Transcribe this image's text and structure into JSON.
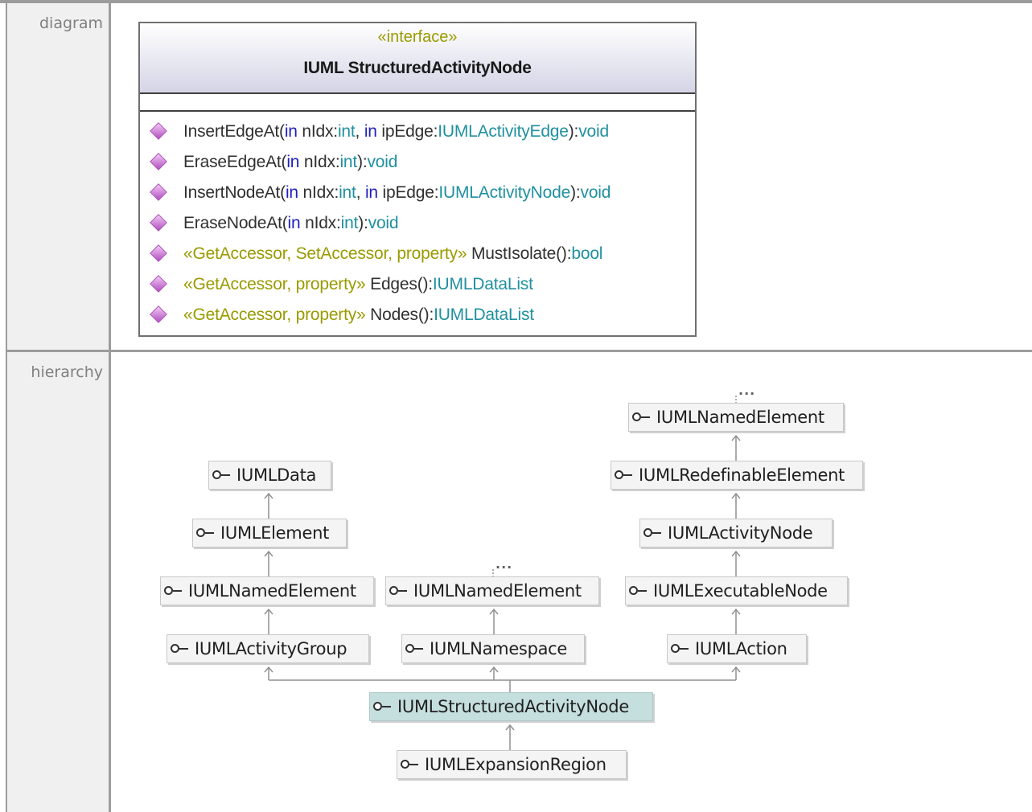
{
  "sections": {
    "diagram_label": "diagram",
    "hierarchy_label": "hierarchy"
  },
  "interface": {
    "stereotype": "«interface»",
    "name": "IUML StructuredActivityNode",
    "operations": [
      {
        "parts": [
          [
            "n",
            "InsertEdgeAt("
          ],
          [
            "k",
            "in"
          ],
          [
            "n",
            " nIdx:"
          ],
          [
            "t",
            "int"
          ],
          [
            "n",
            ", "
          ],
          [
            "k",
            "in"
          ],
          [
            "n",
            " ipEdge:"
          ],
          [
            "t",
            "IUMLActivityEdge"
          ],
          [
            "n",
            "):"
          ],
          [
            "t",
            "void"
          ]
        ]
      },
      {
        "parts": [
          [
            "n",
            "EraseEdgeAt("
          ],
          [
            "k",
            "in"
          ],
          [
            "n",
            " nIdx:"
          ],
          [
            "t",
            "int"
          ],
          [
            "n",
            "):"
          ],
          [
            "t",
            "void"
          ]
        ]
      },
      {
        "parts": [
          [
            "n",
            "InsertNodeAt("
          ],
          [
            "k",
            "in"
          ],
          [
            "n",
            " nIdx:"
          ],
          [
            "t",
            "int"
          ],
          [
            "n",
            ", "
          ],
          [
            "k",
            "in"
          ],
          [
            "n",
            " ipEdge:"
          ],
          [
            "t",
            "IUMLActivityNode"
          ],
          [
            "n",
            "):"
          ],
          [
            "t",
            "void"
          ]
        ]
      },
      {
        "parts": [
          [
            "n",
            "EraseNodeAt("
          ],
          [
            "k",
            "in"
          ],
          [
            "n",
            " nIdx:"
          ],
          [
            "t",
            "int"
          ],
          [
            "n",
            "):"
          ],
          [
            "t",
            "void"
          ]
        ]
      },
      {
        "parts": [
          [
            "s",
            "«GetAccessor, SetAccessor, property»"
          ],
          [
            "n",
            " MustIsolate():"
          ],
          [
            "t",
            "bool"
          ]
        ]
      },
      {
        "parts": [
          [
            "s",
            "«GetAccessor, property»"
          ],
          [
            "n",
            " Edges():"
          ],
          [
            "t",
            "IUMLDataList"
          ]
        ]
      },
      {
        "parts": [
          [
            "s",
            "«GetAccessor, property»"
          ],
          [
            "n",
            " Nodes():"
          ],
          [
            "t",
            "IUMLDataList"
          ]
        ]
      }
    ]
  },
  "hierarchy": {
    "nodes": {
      "data": "IUMLData",
      "element": "IUMLElement",
      "named_left": "IUMLNamedElement",
      "activity_group": "IUMLActivityGroup",
      "named_mid": "IUMLNamedElement",
      "namespace": "IUMLNamespace",
      "named_right": "IUMLNamedElement",
      "redefinable": "IUMLRedefinableElement",
      "activity_node": "IUMLActivityNode",
      "executable_node": "IUMLExecutableNode",
      "action": "IUMLAction",
      "structured": "IUMLStructuredActivityNode",
      "expansion": "IUMLExpansionRegion"
    },
    "more_mid": "...",
    "more_right": "..."
  }
}
